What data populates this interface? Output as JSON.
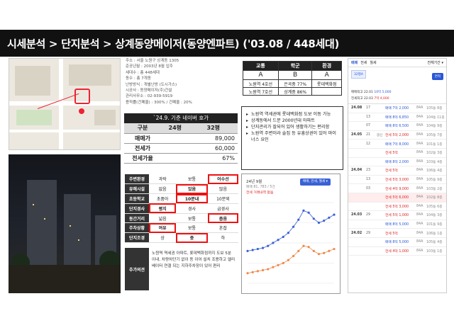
{
  "header": {
    "title": "시세분석 > 단지분석 > 상계동양메이저(동양엔파트) ('03.08 / 448세대)"
  },
  "info": {
    "lines": [
      "주소 : 서울 노원구 상계동 1305",
      "준공년월 : 2003년 8월 입주",
      "세대수 : 총 448세대",
      "동수 : 총 7개동",
      "난방방식 : 개별난방 (도시가스)",
      "시공사 : 동양메이저(주)건설",
      "관리사무소 : 02-939-5919",
      "용적률(건폐율) : 300% / 건폐율 : 20%"
    ]
  },
  "price_table": {
    "heading": "`24.9. 기준 네이버 호가",
    "columns": [
      "구분",
      "24평",
      "32평"
    ],
    "rows": [
      {
        "label": "매매가",
        "p24": "",
        "p32": "89,000"
      },
      {
        "label": "전세가",
        "p24": "",
        "p32": "60,000"
      },
      {
        "label": "전세가율",
        "p24": "",
        "p32": "67%"
      }
    ]
  },
  "attributes": {
    "rows": [
      {
        "key": "주변환경",
        "vals": [
          "과락",
          "보통",
          "어수선"
        ],
        "hl": 2
      },
      {
        "key": "유해시설",
        "vals": [
          "없음",
          "있음",
          "많음"
        ],
        "hl": 1
      },
      {
        "key": "초등학교",
        "vals": [
          "초품아",
          "10분내",
          "10분외"
        ],
        "hl": 1
      },
      {
        "key": "단지경사",
        "vals": [
          "평지",
          "경사",
          "급경사"
        ],
        "hl": 0
      },
      {
        "key": "동간거리",
        "vals": [
          "넓음",
          "보통",
          "좁음"
        ],
        "hl": 2
      },
      {
        "key": "주차상황",
        "vals": [
          "여유",
          "보통",
          "혼잡"
        ],
        "hl": 0
      },
      {
        "key": "단지조경",
        "vals": [
          "상",
          "중",
          "하"
        ],
        "hl": 1
      }
    ],
    "comment_key": "추가의견",
    "comment": "노원역 역세권 아파트, 롯데백화점까지 도보 5분 이내, 차량차단기 없이 동 이어 설치 조용하고 엘리베이터 연결 되는 지하주차장이 있어 편리"
  },
  "grade": {
    "headers": [
      "교통",
      "학군",
      "환경"
    ],
    "grades": [
      "A",
      "B",
      "A"
    ],
    "sub_rows": [
      [
        "노원역 4호선",
        "은곡중 77%",
        "롯데백화점"
      ],
      [
        "노원역 7호선",
        "상계중 86%",
        ""
      ]
    ]
  },
  "notes": {
    "items": [
      "노원역 역세권에 롯데백화점 도보 이동 가능",
      "상계동에서 드문 2000년대 아파트",
      "단지관리가 잘되어 있어 생활하기는 편리함",
      "노원역 주변이라 술집 등 유흥상권이 있어 마이너스 요인"
    ]
  },
  "chart_box": {
    "title": "24년 9월",
    "subtitle": "매매 81, 783 / 5건",
    "red_text": "전세 거래내역 없음",
    "chip": "매매, 전세, 월세 ▾"
  },
  "chart_data": {
    "type": "line",
    "series": [
      {
        "name": "매매",
        "values": [
          52,
          53,
          54,
          55,
          57,
          60,
          63,
          66,
          70,
          76,
          83,
          92,
          90,
          84,
          80,
          82,
          85,
          88
        ]
      },
      {
        "name": "전세",
        "values": [
          30,
          31,
          32,
          33,
          34,
          36,
          38,
          40,
          43,
          47,
          52,
          57,
          56,
          52,
          49,
          50,
          52,
          54
        ]
      }
    ],
    "ylim": [
      20,
      100
    ],
    "grid": true,
    "colors": {
      "매매": "#3a62d6",
      "전세": "#f08a4b"
    }
  },
  "right_panel": {
    "tabs": [
      "매매",
      "전세",
      "월세"
    ],
    "active_tab": 0,
    "badge": "32평A",
    "button": "전체기간 ▾",
    "btn2": "면적",
    "line1_label": "매매최고",
    "line1_date": "22.01",
    "line1_val": "10억 5,000",
    "line2_label": "전세최고",
    "line2_date": "22.03",
    "line2_val": "7억 4,000",
    "rows": [
      {
        "date": "24.08",
        "day": "17",
        "type": "",
        "price": "매매 7억 2,000",
        "area": "84A",
        "floor": "105동 8층",
        "red": false,
        "hl": false
      },
      {
        "date": "",
        "day": "13",
        "type": "",
        "price": "매매 8억 6,850",
        "area": "84A",
        "floor": "104동 11층",
        "red": false,
        "hl": false
      },
      {
        "date": "",
        "day": "07",
        "type": "",
        "price": "매매 8억 6,500",
        "area": "84A",
        "floor": "104동 9층",
        "red": false,
        "hl": false
      },
      {
        "date": "24.05",
        "day": "21",
        "type": "갱신",
        "price": "전세 5억 2,000",
        "area": "84A",
        "floor": "105동 7층",
        "red": true,
        "hl": false
      },
      {
        "date": "",
        "day": "12",
        "type": "",
        "price": "매매 7억 8,000",
        "area": "84A",
        "floor": "101동 1층",
        "red": false,
        "hl": false
      },
      {
        "date": "",
        "day": "",
        "type": "",
        "price": "전세 5억",
        "area": "84A",
        "floor": "102동 3층",
        "red": true,
        "hl": false
      },
      {
        "date": "",
        "day": "",
        "type": "",
        "price": "매매 8억 2,000",
        "area": "84A",
        "floor": "103동 4층",
        "red": false,
        "hl": false
      },
      {
        "date": "24.04",
        "day": "23",
        "type": "",
        "price": "전세 5억",
        "area": "84A",
        "floor": "106동 4층",
        "red": true,
        "hl": false
      },
      {
        "date": "",
        "day": "13",
        "type": "",
        "price": "전세 5억 3,000",
        "area": "84A",
        "floor": "105동 9층",
        "red": true,
        "hl": false
      },
      {
        "date": "",
        "day": "03",
        "type": "",
        "price": "전세 4억 9,000",
        "area": "84A",
        "floor": "103동 2층",
        "red": true,
        "hl": false
      },
      {
        "date": "",
        "day": "",
        "type": "",
        "price": "전세 5억 6,000",
        "area": "84A",
        "floor": "102동 8층",
        "red": true,
        "hl": true
      },
      {
        "date": "",
        "day": "",
        "type": "",
        "price": "전세 5억 3,000",
        "area": "84A",
        "floor": "105동 6층",
        "red": true,
        "hl": false
      },
      {
        "date": "24.03",
        "day": "29",
        "type": "",
        "price": "전세 5억 1,000",
        "area": "84A",
        "floor": "104동 3층",
        "red": true,
        "hl": false
      },
      {
        "date": "",
        "day": "",
        "type": "",
        "price": "매매 8억 5,000",
        "area": "84A",
        "floor": "101동 9층",
        "red": false,
        "hl": false
      },
      {
        "date": "24.02",
        "day": "29",
        "type": "",
        "price": "전세 5억",
        "area": "84A",
        "floor": "106동 1층",
        "red": true,
        "hl": false
      },
      {
        "date": "",
        "day": "",
        "type": "",
        "price": "매매 8억 5,000",
        "area": "84A",
        "floor": "105동 4층",
        "red": false,
        "hl": false
      },
      {
        "date": "",
        "day": "",
        "type": "",
        "price": "전세 4억 1,000",
        "area": "84A",
        "floor": "103동 1층",
        "red": true,
        "hl": false
      }
    ]
  }
}
